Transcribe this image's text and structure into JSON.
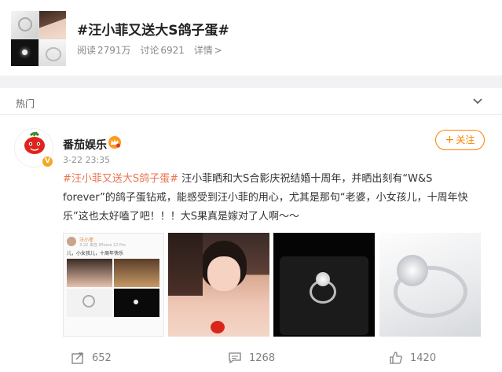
{
  "topic": {
    "title": "#汪小菲又送大S鸽子蛋#",
    "read_label": "阅读",
    "read_count": "2791万",
    "discuss_label": "讨论",
    "discuss_count": "6921",
    "details_label": "详情"
  },
  "section": {
    "label": "热门"
  },
  "post": {
    "username": "番茄娱乐",
    "time": "3-22 23:35",
    "follow_label": "关注",
    "hashtag": "#汪小菲又送大S鸽子蛋#",
    "text": " 汪小菲晒和大S合影庆祝结婚十周年，并晒出刻有“W&S forever”的鸽子蛋钻戒，能感受到汪小菲的用心，尤其是那句“老婆，小女孩儿，十周年快乐”这也太好嗑了吧！！！大S果真是嫁对了人啊～～",
    "avatar_text": "番茄娱乐",
    "image1": {
      "name": "汪小菲",
      "meta": "3-22 来自 iPhone 12 Pro",
      "caption": "儿，小女孩儿，十周年快乐"
    }
  },
  "actions": {
    "repost_count": "652",
    "comment_count": "1268",
    "like_count": "1420"
  },
  "colors": {
    "accent": "#ff8200",
    "hashtag": "#eb7350",
    "badge": "#f5a623"
  },
  "icons": [
    "collapse-chevron-icon",
    "verified-icon",
    "vip-crown-icon",
    "plus-icon",
    "repost-icon",
    "comment-icon",
    "like-icon"
  ]
}
